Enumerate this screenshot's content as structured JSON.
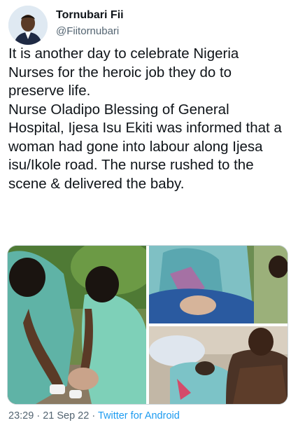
{
  "user": {
    "display_name": "Tornubari Fii",
    "handle": "@Fiitornubari"
  },
  "tweet": {
    "paragraph_1": "It is another day to celebrate Nigeria Nurses for the heroic job they do to preserve life.",
    "paragraph_2": "Nurse Oladipo Blessing of General Hospital, Ijesa Isu Ekiti was informed that a woman had gone into labour along Ijesa isu/Ikole road. The nurse rushed to the scene & delivered the baby."
  },
  "meta": {
    "time": "23:29",
    "separator_1": " · ",
    "date": "21 Sep 22",
    "separator_2": " · ",
    "source": "Twitter for Android"
  },
  "colors": {
    "text": "#0f1419",
    "secondary": "#536471",
    "link": "#1d9bf0"
  }
}
